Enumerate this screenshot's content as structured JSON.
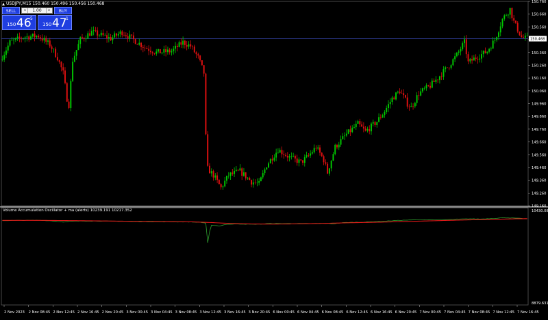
{
  "header": {
    "symbol_line": "USDJPY,M15  150.460 150.496 150.456 150.468"
  },
  "trade_panel": {
    "sell_label": "SELL",
    "buy_label": "BUY",
    "lot_value": "1.00",
    "sell_price_prefix": "150",
    "sell_price_main": "46",
    "sell_price_sup": "5",
    "buy_price_prefix": "150",
    "buy_price_main": "47",
    "buy_price_sup": "1"
  },
  "colors": {
    "background": "#000000",
    "bull_candle": "#00c800",
    "bear_candle": "#e01010",
    "grid": "#0f1a30",
    "bid_line": "#2b3a8c",
    "osc_line": "#2fa02f",
    "ma_line": "#e01818",
    "panel_button": "#1f3ee0"
  },
  "chart_data": [
    {
      "type": "candlestick",
      "symbol": "USDJPY",
      "timeframe": "M15",
      "ohlc_header": {
        "open": 150.46,
        "high": 150.496,
        "low": 150.456,
        "close": 150.468
      },
      "current_bid_label": "150.468",
      "current_bid": 150.468,
      "ylim": [
        149.16,
        150.76
      ],
      "y_ticks": [
        "150.760",
        "150.660",
        "150.560",
        "150.460",
        "150.360",
        "150.260",
        "150.160",
        "150.060",
        "149.960",
        "149.860",
        "149.760",
        "149.660",
        "149.560",
        "149.460",
        "149.360",
        "149.260",
        "149.160"
      ],
      "x_ticks": [
        "2 Nov 2023",
        "2 Nov 08:45",
        "2 Nov 12:45",
        "2 Nov 16:45",
        "2 Nov 20:45",
        "3 Nov 00:45",
        "3 Nov 04:45",
        "3 Nov 08:45",
        "3 Nov 12:45",
        "3 Nov 16:45",
        "3 Nov 20:45",
        "6 Nov 00:45",
        "6 Nov 04:45",
        "6 Nov 08:45",
        "6 Nov 12:45",
        "6 Nov 16:45",
        "6 Nov 20:45",
        "7 Nov 00:45",
        "7 Nov 04:45",
        "7 Nov 08:45",
        "7 Nov 12:45",
        "7 Nov 16:45"
      ],
      "price_path": [
        [
          0,
          150.3
        ],
        [
          5,
          150.44
        ],
        [
          12,
          150.48
        ],
        [
          20,
          150.49
        ],
        [
          26,
          150.42
        ],
        [
          30,
          150.32
        ],
        [
          33,
          150.2
        ],
        [
          35,
          150.0
        ],
        [
          36,
          149.95
        ],
        [
          38,
          150.3
        ],
        [
          42,
          150.46
        ],
        [
          48,
          150.52
        ],
        [
          52,
          150.5
        ],
        [
          58,
          150.47
        ],
        [
          64,
          150.52
        ],
        [
          70,
          150.46
        ],
        [
          76,
          150.4
        ],
        [
          82,
          150.36
        ],
        [
          90,
          150.37
        ],
        [
          96,
          150.44
        ],
        [
          100,
          150.41
        ],
        [
          104,
          150.32
        ],
        [
          107,
          150.2
        ],
        [
          108,
          149.7
        ],
        [
          109,
          149.45
        ],
        [
          112,
          149.4
        ],
        [
          116,
          149.3
        ],
        [
          120,
          149.4
        ],
        [
          126,
          149.43
        ],
        [
          132,
          149.35
        ],
        [
          136,
          149.33
        ],
        [
          140,
          149.48
        ],
        [
          146,
          149.6
        ],
        [
          152,
          149.54
        ],
        [
          158,
          149.5
        ],
        [
          162,
          149.55
        ],
        [
          166,
          149.62
        ],
        [
          170,
          149.52
        ],
        [
          172,
          149.42
        ],
        [
          176,
          149.62
        ],
        [
          182,
          149.72
        ],
        [
          188,
          149.8
        ],
        [
          192,
          149.74
        ],
        [
          198,
          149.82
        ],
        [
          202,
          149.9
        ],
        [
          206,
          150.0
        ],
        [
          210,
          150.06
        ],
        [
          214,
          149.96
        ],
        [
          216,
          149.93
        ],
        [
          220,
          150.04
        ],
        [
          226,
          150.1
        ],
        [
          230,
          150.16
        ],
        [
          236,
          150.26
        ],
        [
          240,
          150.34
        ],
        [
          244,
          150.44
        ],
        [
          246,
          150.28
        ],
        [
          250,
          150.32
        ],
        [
          256,
          150.37
        ],
        [
          260,
          150.46
        ],
        [
          264,
          150.62
        ],
        [
          268,
          150.7
        ],
        [
          270,
          150.6
        ],
        [
          274,
          150.48
        ],
        [
          276,
          150.47
        ]
      ],
      "price_range_hint": [
        149.2,
        150.72
      ]
    },
    {
      "type": "line",
      "title": "Volume Accumulation Oscillator + ma (alerts) 10239.191 10217.352",
      "series": [
        {
          "name": "oscillator",
          "color": "#2fa02f",
          "values": [
            [
              0,
              10236
            ],
            [
              10,
              10240
            ],
            [
              20,
              10241
            ],
            [
              26,
              10232
            ],
            [
              30,
              10220
            ],
            [
              33,
              10213
            ],
            [
              36,
              10226
            ],
            [
              42,
              10229
            ],
            [
              52,
              10229
            ],
            [
              62,
              10225
            ],
            [
              72,
              10220
            ],
            [
              82,
              10217
            ],
            [
              92,
              10216
            ],
            [
              100,
              10214
            ],
            [
              104,
              10210
            ],
            [
              107,
              10196
            ],
            [
              108,
              9880
            ],
            [
              109,
              10060
            ],
            [
              110,
              10160
            ],
            [
              114,
              10150
            ],
            [
              118,
              10178
            ],
            [
              124,
              10182
            ],
            [
              130,
              10178
            ],
            [
              136,
              10180
            ],
            [
              140,
              10190
            ],
            [
              150,
              10188
            ],
            [
              160,
              10188
            ],
            [
              170,
              10192
            ],
            [
              174,
              10185
            ],
            [
              180,
              10205
            ],
            [
              190,
              10212
            ],
            [
              200,
              10226
            ],
            [
              210,
              10242
            ],
            [
              220,
              10250
            ],
            [
              230,
              10250
            ],
            [
              240,
              10260
            ],
            [
              246,
              10265
            ],
            [
              252,
              10262
            ],
            [
              258,
              10270
            ],
            [
              264,
              10283
            ],
            [
              270,
              10275
            ],
            [
              276,
              10264
            ]
          ]
        },
        {
          "name": "ma",
          "color": "#e01818",
          "values": [
            [
              0,
              10240
            ],
            [
              20,
              10240
            ],
            [
              40,
              10235
            ],
            [
              60,
              10228
            ],
            [
              80,
              10222
            ],
            [
              100,
              10216
            ],
            [
              110,
              10205
            ],
            [
              120,
              10190
            ],
            [
              130,
              10183
            ],
            [
              140,
              10180
            ],
            [
              150,
              10182
            ],
            [
              160,
              10186
            ],
            [
              170,
              10192
            ],
            [
              180,
              10200
            ],
            [
              190,
              10206
            ],
            [
              200,
              10212
            ],
            [
              210,
              10220
            ],
            [
              220,
              10228
            ],
            [
              230,
              10236
            ],
            [
              240,
              10244
            ],
            [
              250,
              10251
            ],
            [
              260,
              10258
            ],
            [
              270,
              10265
            ],
            [
              276,
              10267
            ]
          ]
        }
      ],
      "ylim": [
        8879.631,
        10430.08
      ],
      "y_ticks": [
        "10430.08",
        "8879.631"
      ]
    }
  ]
}
